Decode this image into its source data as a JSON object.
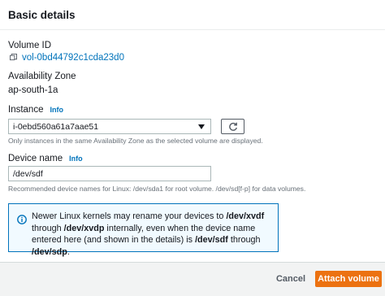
{
  "panel": {
    "title": "Basic details"
  },
  "volume_id": {
    "label": "Volume ID",
    "value": "vol-0bd44792c1cda23d0",
    "icon": "copy-icon"
  },
  "availability_zone": {
    "label": "Availability Zone",
    "value": "ap-south-1a"
  },
  "instance": {
    "label": "Instance",
    "info": "Info",
    "selected": "i-0ebd560a61a7aae51",
    "hint": "Only instances in the same Availability Zone as the selected volume are displayed.",
    "refresh_icon": "refresh-icon"
  },
  "device_name": {
    "label": "Device name",
    "info": "Info",
    "value": "/dev/sdf",
    "hint": "Recommended device names for Linux: /dev/sda1 for root volume. /dev/sd[f-p] for data volumes."
  },
  "alert": {
    "icon": "info-circle-icon",
    "t1": "Newer Linux kernels may rename your devices to ",
    "b1": "/dev/xvdf",
    "t2": " through ",
    "b2": "/dev/xvdp",
    "t3": " internally, even when the device name entered here (and shown in the details) is ",
    "b3": "/dev/sdf",
    "t4": " through ",
    "b4": "/dev/sdp",
    "t5": "."
  },
  "footer": {
    "cancel": "Cancel",
    "attach": "Attach volume"
  },
  "colors": {
    "accent": "#ec7211",
    "link": "#0073bb",
    "alert_bg": "#f1faff"
  }
}
